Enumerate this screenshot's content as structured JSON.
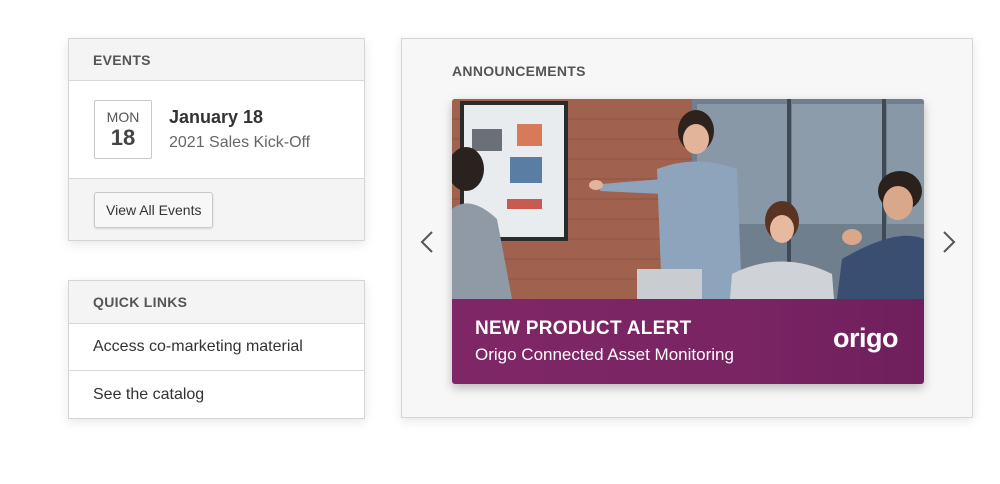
{
  "events": {
    "header": "EVENTS",
    "item": {
      "day_of_week": "MON",
      "day": "18",
      "date": "January 18",
      "title": "2021 Sales Kick-Off"
    },
    "view_all_label": "View All Events"
  },
  "quick_links": {
    "header": "QUICK LINKS",
    "items": [
      {
        "label": "Access co-marketing material"
      },
      {
        "label": "See the catalog"
      }
    ]
  },
  "announcements": {
    "header": "ANNOUNCEMENTS",
    "prev_icon": "chevron-left-icon",
    "next_icon": "chevron-right-icon",
    "slide": {
      "title": "NEW PRODUCT ALERT",
      "subtitle": "Origo Connected Asset Monitoring",
      "logo_text": "origo",
      "banner_color": "#7b2565"
    }
  }
}
